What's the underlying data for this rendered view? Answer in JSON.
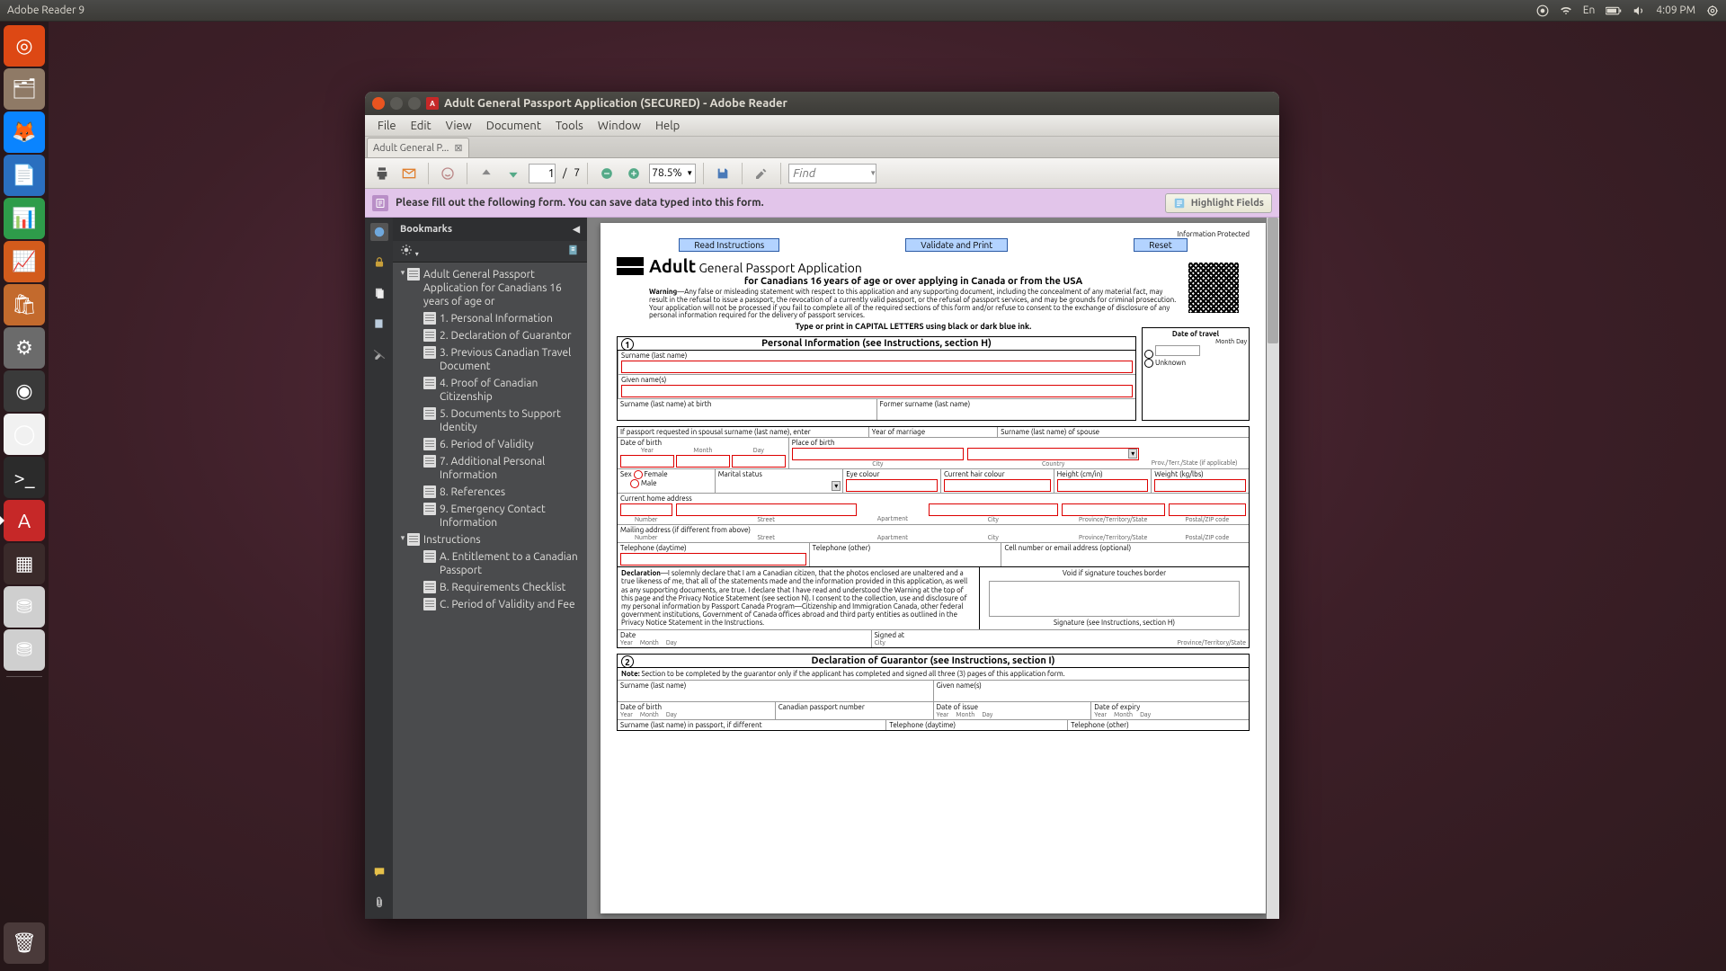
{
  "topbar": {
    "app_title": "Adobe Reader 9",
    "lang": "En",
    "time": "4:09 PM"
  },
  "launcher": {
    "items": [
      {
        "name": "dash-icon",
        "color": "#dd4814",
        "glyph": "◎"
      },
      {
        "name": "files-icon",
        "color": "#8f7a66",
        "glyph": "🗂"
      },
      {
        "name": "firefox-icon",
        "color": "#0a84ff",
        "glyph": "🦊"
      },
      {
        "name": "writer-icon",
        "color": "#2a6fbf",
        "glyph": "📄"
      },
      {
        "name": "calc-icon",
        "color": "#2e9c4a",
        "glyph": "📊"
      },
      {
        "name": "impress-icon",
        "color": "#d35b1c",
        "glyph": "📈"
      },
      {
        "name": "software-icon",
        "color": "#c36a2d",
        "glyph": "🛍"
      },
      {
        "name": "settings-icon",
        "color": "#6b6b6b",
        "glyph": "⚙"
      },
      {
        "name": "steam-icon",
        "color": "#3a3a3a",
        "glyph": "◉"
      },
      {
        "name": "chrome-icon",
        "color": "#f1f1f1",
        "glyph": "◯"
      },
      {
        "name": "terminal-icon",
        "color": "#2b2b2b",
        "glyph": ">_"
      },
      {
        "name": "adobe-reader-icon",
        "color": "#c62828",
        "glyph": "A",
        "active": true
      },
      {
        "name": "workspace-icon",
        "color": "#3a2a2a",
        "glyph": "▦"
      },
      {
        "name": "drive-1-icon",
        "color": "#cfcfcf",
        "glyph": "⛃"
      },
      {
        "name": "drive-2-icon",
        "color": "#cfcfcf",
        "glyph": "⛃"
      }
    ],
    "trash": {
      "name": "trash-icon",
      "glyph": "🗑"
    }
  },
  "window": {
    "title": "Adult General Passport Application (SECURED) - Adobe Reader",
    "menus": [
      "File",
      "Edit",
      "View",
      "Document",
      "Tools",
      "Window",
      "Help"
    ],
    "tab_label": "Adult General P...",
    "page_current": "1",
    "page_total": "7",
    "page_sep": "/",
    "zoom": "78.5%",
    "find_placeholder": "Find",
    "form_msg": "Please fill out the following form. You can save data typed into this form.",
    "highlight_btn": "Highlight Fields",
    "bookmarks_title": "Bookmarks"
  },
  "bookmarks": [
    {
      "lvl": 1,
      "exp": "-",
      "label": "Adult General Passport Application for Canadians 16 years of age or"
    },
    {
      "lvl": 2,
      "label": "1. Personal Information"
    },
    {
      "lvl": 2,
      "label": "2. Declaration of Guarantor"
    },
    {
      "lvl": 2,
      "label": "3. Previous Canadian Travel Document"
    },
    {
      "lvl": 2,
      "label": "4. Proof of Canadian Citizenship"
    },
    {
      "lvl": 2,
      "label": "5. Documents to Support Identity"
    },
    {
      "lvl": 2,
      "label": "6. Period of Validity"
    },
    {
      "lvl": 2,
      "label": "7. Additional Personal Information"
    },
    {
      "lvl": 2,
      "label": "8. References"
    },
    {
      "lvl": 2,
      "label": "9. Emergency Contact Information"
    },
    {
      "lvl": 1,
      "exp": "-",
      "label": "Instructions"
    },
    {
      "lvl": 2,
      "label": "A. Entitlement to a Canadian Passport"
    },
    {
      "lvl": 2,
      "label": "B. Requirements Checklist"
    },
    {
      "lvl": 2,
      "label": "C. Period of Validity and Fee"
    }
  ],
  "doc": {
    "btn_read": "Read Instructions",
    "btn_validate": "Validate and Print",
    "btn_reset": "Reset",
    "info_protected": "Information Protected",
    "title_bold": "Adult",
    "title_rest": " General Passport Application",
    "subline": "for Canadians 16 years of age or over applying in Canada or from the USA",
    "warning_label": "Warning",
    "warning_text": "—Any false or misleading statement with respect to this application and any supporting document, including the concealment of any material fact, may result in the refusal to issue a passport, the revocation of a currently valid passport, or the refusal of passport services, and may be grounds for criminal prosecution. Your application will not be processed if you fail to complete all of the required sections of this form and/or refuse to consent to the exchange of disclosure of any personal information required for the delivery of passport services.",
    "type_instr": "Type or print in CAPITAL LETTERS using black or dark blue ink.",
    "sec1_num": "1",
    "sec1_title": "Personal Information (see Instructions, section H)",
    "surname": "Surname (last name)",
    "given": "Given name(s)",
    "surname_birth": "Surname (last name) at birth",
    "former_surname": "Former surname (last name)",
    "travel_date": "Date of travel",
    "month": "Month",
    "day": "Day",
    "unknown": "Unknown",
    "spousal": "If passport requested in spousal surname (last name), enter",
    "year_marriage": "Year of marriage",
    "surname_spouse": "Surname (last name) of spouse",
    "dob": "Date of birth",
    "year": "Year",
    "pob": "Place of birth",
    "city": "City",
    "country": "Country",
    "prov_terr": "Prov./Terr./State (if applicable)",
    "sex": "Sex",
    "female": "Female",
    "male": "Male",
    "marital": "Marital status",
    "eye": "Eye colour",
    "hair": "Current hair colour",
    "height": "Height (cm/in)",
    "weight": "Weight (kg/lbs)",
    "home_addr": "Current home address",
    "number": "Number",
    "street": "Street",
    "apartment": "Apartment",
    "province": "Province/Territory/State",
    "postal": "Postal/ZIP code",
    "mailing": "Mailing address (if different from above)",
    "tel_day": "Telephone (daytime)",
    "tel_other": "Telephone (other)",
    "cell_email": "Cell number or email address (optional)",
    "decl_label": "Declaration",
    "decl_text": "—I solemnly declare that I am a Canadian citizen, that the photos enclosed are unaltered and a true likeness of me, that all of the statements made and the information provided in this application, as well as any supporting documents, are true. I declare that I have read and understood the Warning at the top of this page and the Privacy Notice Statement (see section N). I consent to the collection, use and disclosure of my personal information by Passport Canada Program—Citizenship and Immigration Canada, other federal government institutions, Government of Canada offices abroad and third party entities as outlined in the Privacy Notice Statement in the Instructions.",
    "void": "Void if signature touches border",
    "sig_instr": "Signature (see Instructions, section H)",
    "date": "Date",
    "signed_at": "Signed at",
    "sec2_num": "2",
    "sec2_title": "Declaration of Guarantor (see Instructions, section I)",
    "note_label": "Note:",
    "note_text": " Section to be completed by the guarantor only if the applicant has completed and signed all three (3) pages of this application form.",
    "three": "three (3)",
    "cdn_passport": "Canadian passport number",
    "date_issue": "Date of issue",
    "date_expiry": "Date of expiry",
    "surname_passport": "Surname (last name) in passport, if different"
  }
}
